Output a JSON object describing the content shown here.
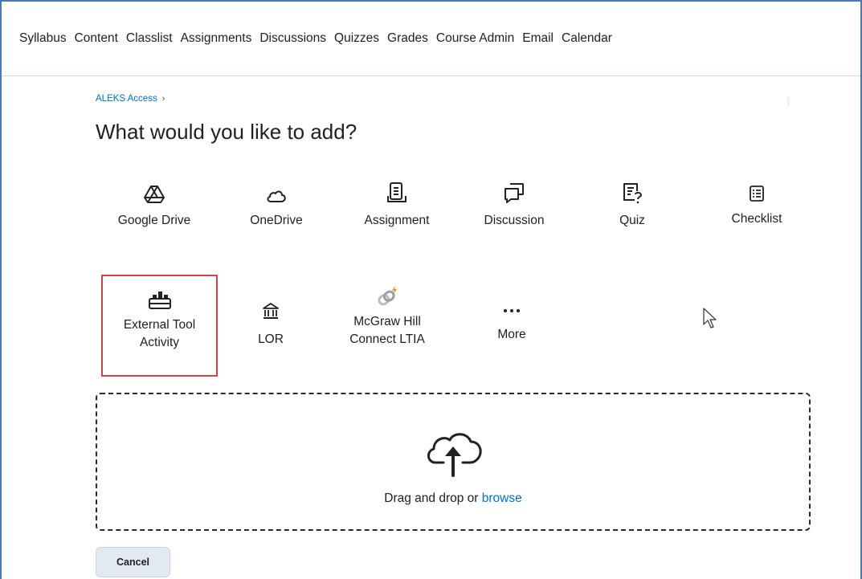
{
  "nav": {
    "items": [
      "Syllabus",
      "Content",
      "Classlist",
      "Assignments",
      "Discussions",
      "Quizzes",
      "Grades",
      "Course Admin",
      "Email",
      "Calendar"
    ]
  },
  "breadcrumb": {
    "label": "ALEKS Access",
    "separator": "›"
  },
  "page": {
    "title": "What would you like to add?"
  },
  "tiles_row1": [
    {
      "label": "Google Drive",
      "icon": "google-drive-icon"
    },
    {
      "label": "OneDrive",
      "icon": "onedrive-icon"
    },
    {
      "label": "Assignment",
      "icon": "assignment-icon"
    },
    {
      "label": "Discussion",
      "icon": "discussion-icon"
    },
    {
      "label": "Quiz",
      "icon": "quiz-icon"
    },
    {
      "label": "Checklist",
      "icon": "checklist-icon"
    }
  ],
  "tiles_row2": [
    {
      "label_line1": "External Tool",
      "label_line2": "Activity",
      "icon": "external-tool-icon",
      "highlighted": true
    },
    {
      "label": "LOR",
      "icon": "lor-icon"
    },
    {
      "label_line1": "McGraw Hill",
      "label_line2": "Connect LTIA",
      "icon": "mcgraw-hill-icon"
    },
    {
      "label": "More",
      "icon": "more-icon"
    }
  ],
  "dropzone": {
    "text": "Drag and drop or",
    "link": "browse",
    "icon": "upload-cloud-icon"
  },
  "actions": {
    "cancel": "Cancel"
  },
  "colors": {
    "accent": "#006fbf",
    "highlight": "#d0454b",
    "frame": "#4a78b5"
  }
}
